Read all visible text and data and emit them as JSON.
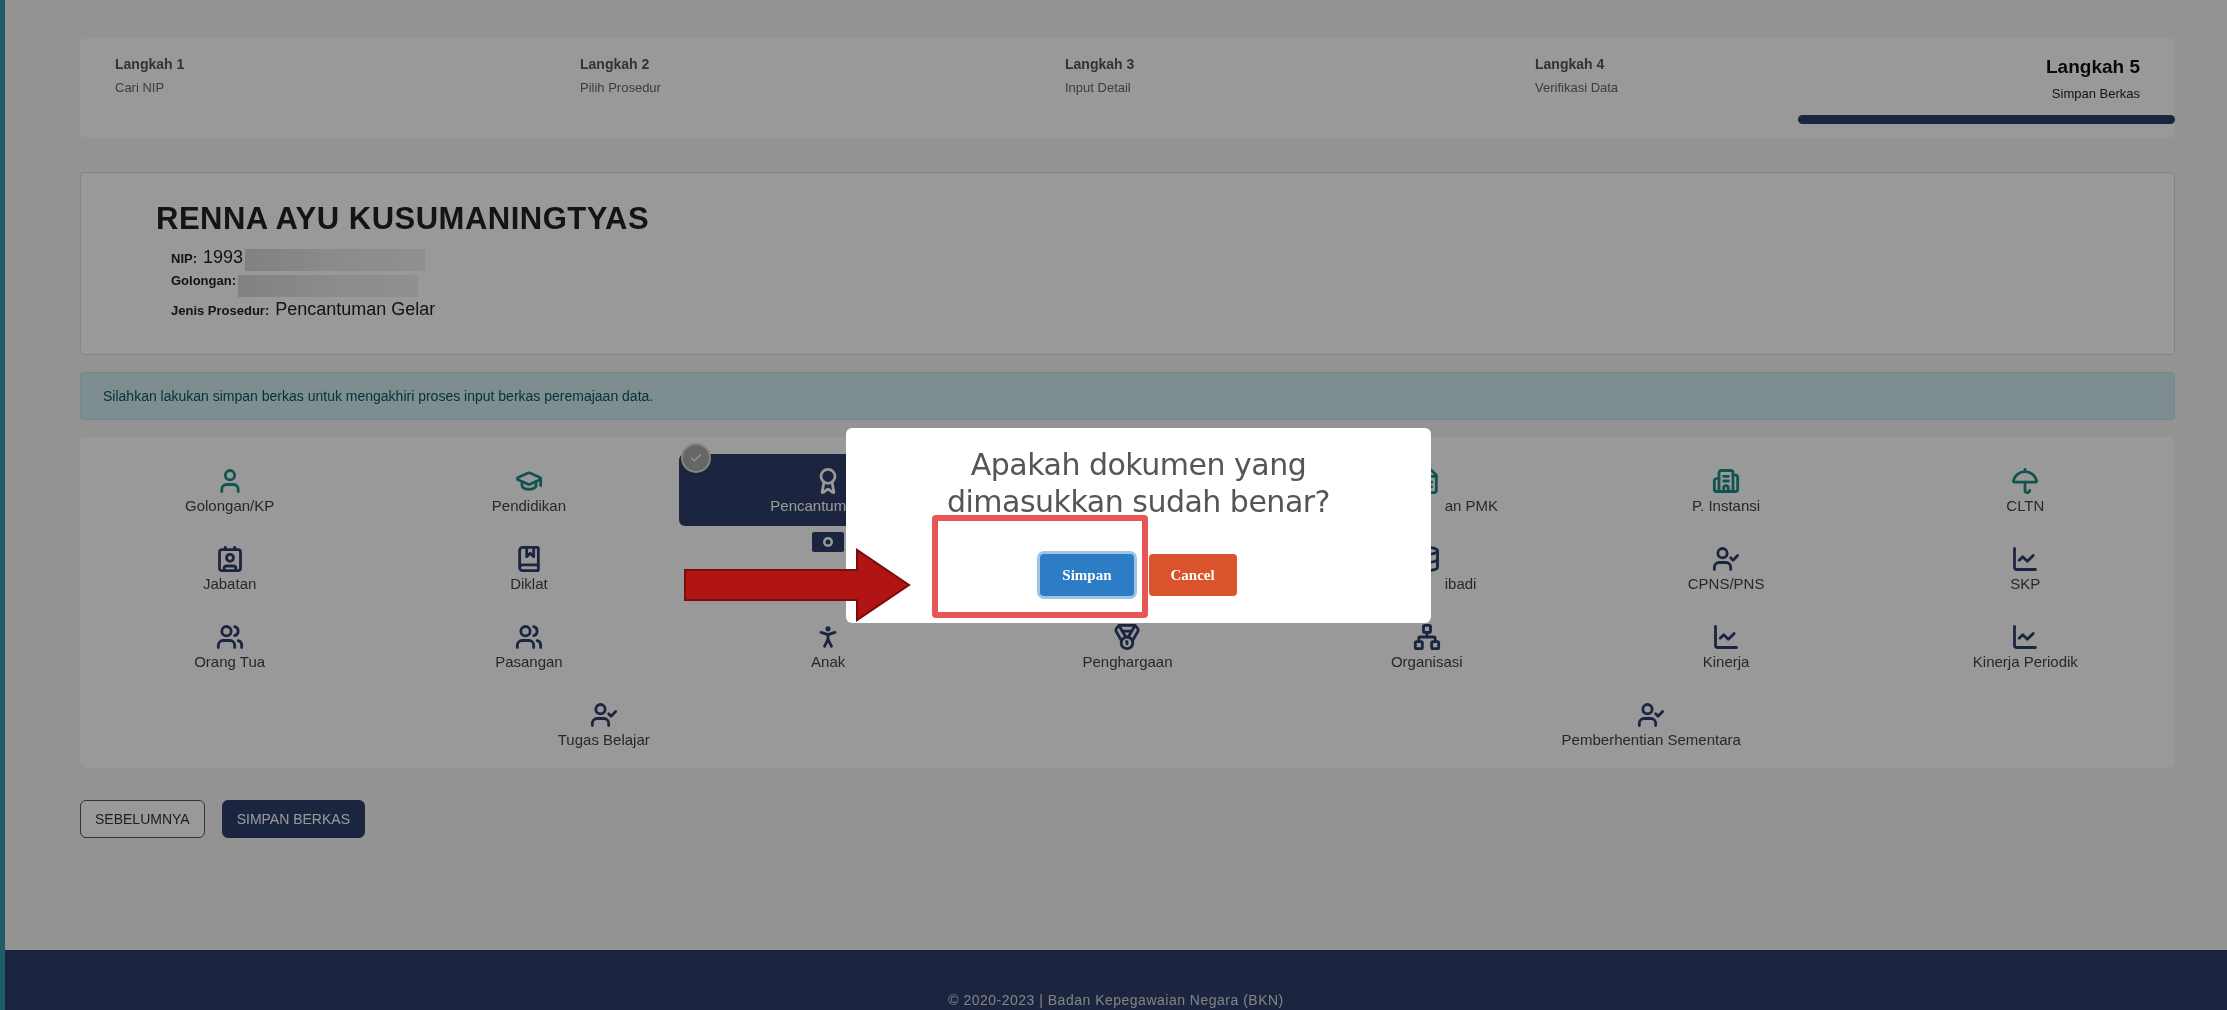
{
  "steps": [
    {
      "label": "Langkah 1",
      "caption": "Cari NIP",
      "selected": false
    },
    {
      "label": "Langkah 2",
      "caption": "Pilih Prosedur",
      "selected": false
    },
    {
      "label": "Langkah 3",
      "caption": "Input Detail",
      "selected": false
    },
    {
      "label": "Langkah 4",
      "caption": "Verifikasi Data",
      "selected": false
    },
    {
      "label": "Langkah 5",
      "caption": "Simpan Berkas",
      "selected": true
    }
  ],
  "profile": {
    "name": "RENNA AYU KUSUMANINGTYAS",
    "fields": [
      {
        "label": "NIP:",
        "value": "1993",
        "redacted": true
      },
      {
        "label": "Golongan:",
        "redacted": true
      },
      {
        "label": "Jenis Prosedur:",
        "value": "Pencantuman Gelar",
        "redacted": false
      }
    ]
  },
  "alert": "Silahkan lakukan simpan berkas untuk mengakhiri proses input berkas peremajaan data.",
  "menu": {
    "rows": [
      [
        {
          "label": "Golongan/KP",
          "kind": "full",
          "selected": false
        },
        {
          "label": "Pendidikan",
          "kind": "full",
          "selected": false
        },
        {
          "label": "Pencantum",
          "kind": "cut_right",
          "selected": true
        },
        {
          "kind": "covered"
        },
        {
          "label": "an PMK",
          "kind": "cut_left",
          "selected": false
        },
        {
          "label": "P. Instansi",
          "kind": "full",
          "selected": false
        },
        {
          "label": "CLTN",
          "kind": "full",
          "selected": false
        }
      ],
      [
        {
          "label": "Jabatan",
          "kind": "full",
          "selected": false
        },
        {
          "label": "Diklat",
          "kind": "full",
          "selected": false
        },
        {
          "kind": "icon_only",
          "selected": false
        },
        {
          "kind": "covered"
        },
        {
          "label": "ibadi",
          "kind": "cut_left",
          "selected": false
        },
        {
          "label": "CPNS/PNS",
          "kind": "full",
          "selected": false
        },
        {
          "label": "SKP",
          "kind": "full",
          "selected": false
        }
      ],
      [
        {
          "label": "Orang Tua",
          "kind": "full",
          "selected": false
        },
        {
          "label": "Pasangan",
          "kind": "full",
          "selected": false
        },
        {
          "label": "Anak",
          "kind": "full",
          "selected": false
        },
        {
          "label": "Penghargaan",
          "kind": "full",
          "selected": false
        },
        {
          "label": "Organisasi",
          "kind": "full",
          "selected": false
        },
        {
          "label": "Kinerja",
          "kind": "full",
          "selected": false
        },
        {
          "label": "Kinerja Periodik",
          "kind": "full",
          "selected": false
        }
      ]
    ],
    "last_row": [
      {
        "label": "Tugas Belajar",
        "kind": "full",
        "selected": false
      },
      {
        "label": "Pemberhentian Sementara",
        "kind": "full",
        "selected": false
      }
    ]
  },
  "buttons": [
    {
      "label": "SEBELUMNYA",
      "kind": "outline"
    },
    {
      "label": "SIMPAN BERKAS",
      "kind": "primary"
    }
  ],
  "footer": "© 2020-2023 | Badan Kepegawaian Negara (BKN)",
  "dialog": {
    "title": "Apakah dokumen yang dimasukkan sudah benar?",
    "buttons": [
      {
        "label": "Simpan",
        "kind": "confirm",
        "focused": true
      },
      {
        "label": "Cancel",
        "kind": "cancel",
        "focused": false
      }
    ]
  }
}
